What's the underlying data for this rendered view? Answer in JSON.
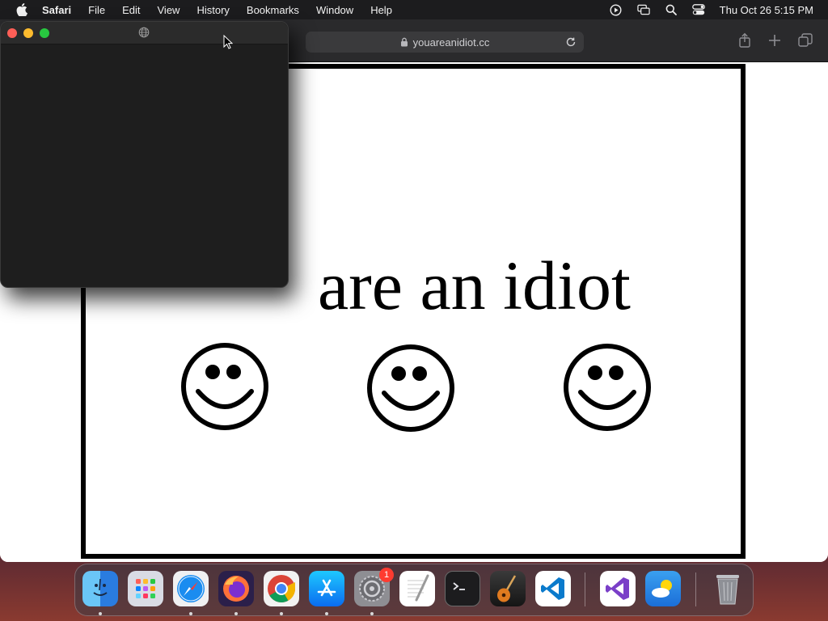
{
  "menubar": {
    "app_name": "Safari",
    "items": [
      "File",
      "Edit",
      "View",
      "History",
      "Bookmarks",
      "Window",
      "Help"
    ],
    "clock": "Thu Oct 26  5:15 PM"
  },
  "safari": {
    "url": "youareanidiot.cc"
  },
  "page": {
    "headline": "are an idiot"
  },
  "dock": {
    "apps": [
      "Finder",
      "Launchpad",
      "Safari",
      "Firefox",
      "Chrome",
      "App Store",
      "System Settings",
      "TextEdit",
      "Terminal",
      "GarageBand",
      "Visual Studio Code",
      "Visual Studio",
      "Weather",
      "Trash"
    ],
    "settings_badge": "1"
  },
  "colors": {
    "close": "#ff5f57",
    "minimize": "#febc2e",
    "zoom": "#28c840",
    "page_border": "#000000",
    "badge": "#ff3b30"
  }
}
